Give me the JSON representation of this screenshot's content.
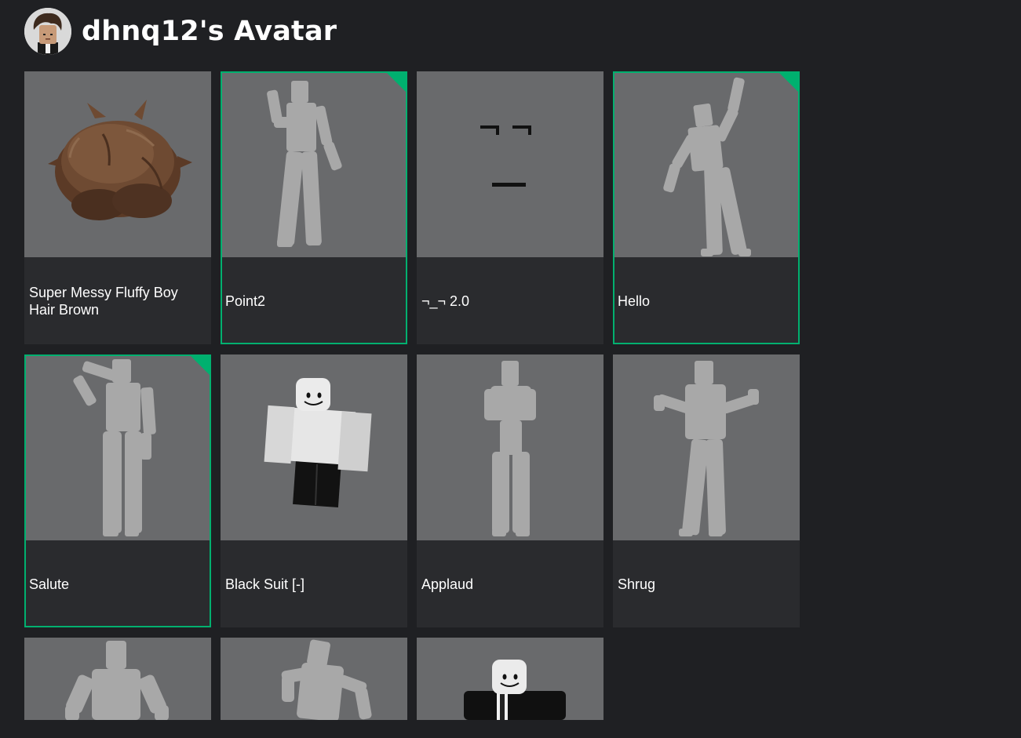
{
  "header": {
    "title": "dhnq12's Avatar"
  },
  "accent_color": "#00b06f",
  "items": [
    {
      "name": "Super Messy Fluffy Boy Hair Brown",
      "equipped": false,
      "icon": "hair-icon"
    },
    {
      "name": "Point2",
      "equipped": true,
      "icon": "point-emote-figure"
    },
    {
      "name": "¬_¬ 2.0",
      "equipped": false,
      "icon": "face-icon"
    },
    {
      "name": "Hello",
      "equipped": true,
      "icon": "wave-emote-figure"
    },
    {
      "name": "Salute",
      "equipped": true,
      "icon": "salute-emote-figure"
    },
    {
      "name": "Black Suit [-]",
      "equipped": false,
      "icon": "suit-outfit-figure"
    },
    {
      "name": "Applaud",
      "equipped": false,
      "icon": "applaud-emote-figure"
    },
    {
      "name": "Shrug",
      "equipped": false,
      "icon": "shrug-emote-figure"
    },
    {
      "name": "",
      "equipped": false,
      "icon": "emote-figure"
    },
    {
      "name": "",
      "equipped": false,
      "icon": "emote-figure"
    },
    {
      "name": "",
      "equipped": false,
      "icon": "suit-figure"
    }
  ]
}
